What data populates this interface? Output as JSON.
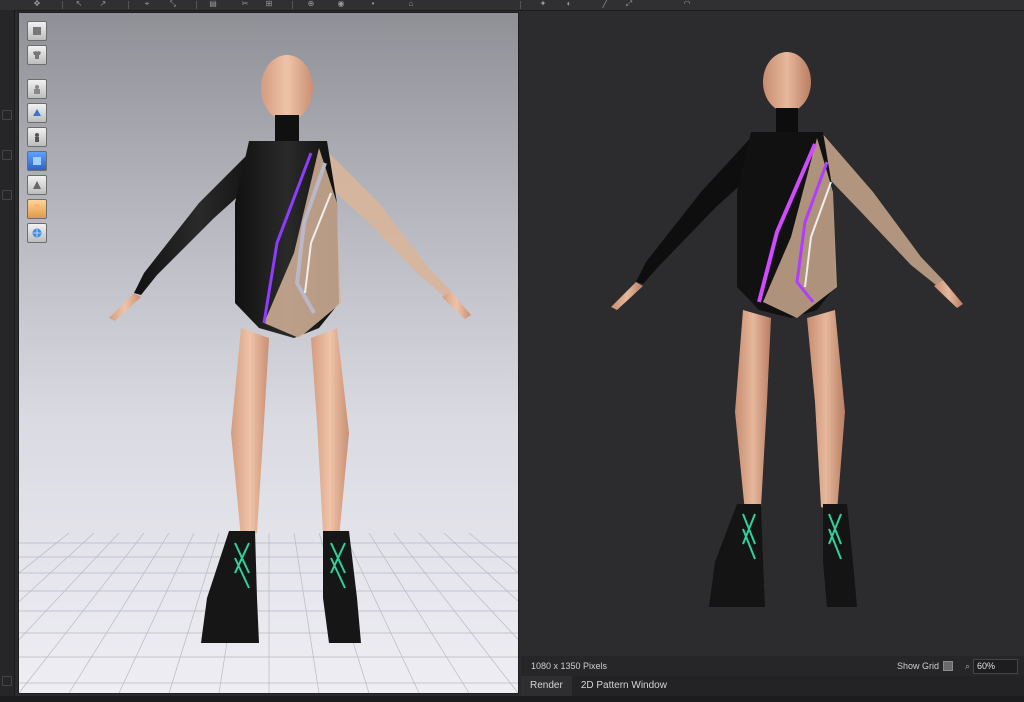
{
  "toolbar": {
    "icons": [
      "select-icon",
      "move-icon",
      "brush-icon",
      "pin-icon",
      "fold-icon",
      "measure-icon",
      "sew-icon",
      "sew-icon",
      "arrange-icon",
      "avatar-icon",
      "point-icon",
      "hanger-icon",
      "shirt-icon"
    ]
  },
  "viewport3d": {
    "tools": [
      "avatar-display-icon",
      "garment-display-icon",
      "show-avatar-icon",
      "show-garment-icon",
      "xray-icon",
      "texture-icon",
      "fabric-icon",
      "skin-icon",
      "environment-icon"
    ]
  },
  "render": {
    "resolution_text": "1080 x 1350 Pixels",
    "show_grid_label": "Show Grid",
    "zoom_value": "60%"
  },
  "tabs": [
    {
      "label": "Render",
      "active": true
    },
    {
      "label": "2D Pattern Window",
      "active": false
    }
  ],
  "colors": {
    "accent_purple": "#9a45ff",
    "boot_lace": "#2fd39a",
    "skin": "#e2b39a"
  }
}
